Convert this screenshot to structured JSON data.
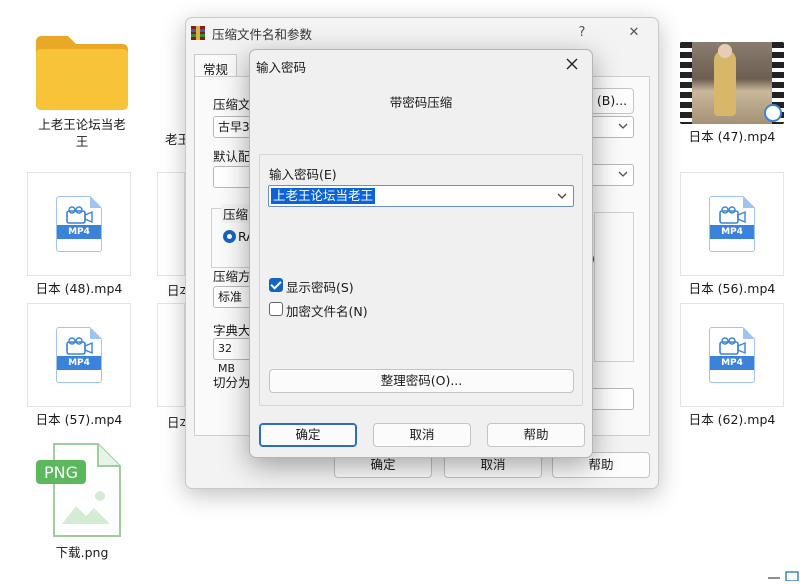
{
  "desktop": {
    "folder_label": "上老王论坛当老王",
    "video_top_right_label": "日本 (47).mp4",
    "png_label": "下载.png",
    "png_badge": "PNG",
    "mp4_badge": "MP4",
    "tiles_mp4": [
      {
        "label": "日本 (48).mp4"
      },
      {
        "label": "日本 (56).mp4"
      },
      {
        "label": "日本 (57).mp4"
      },
      {
        "label": "日本 (62).mp4"
      }
    ],
    "partial_labels": [
      "老王",
      "日本",
      "日本"
    ]
  },
  "back_dialog": {
    "title": "压缩文件名和参数",
    "help_glyph": "?",
    "close_glyph": "✕",
    "tab_general": "常规",
    "label_archive_name": "压缩文",
    "field_archive_name": "古早3",
    "browse_button": "(B)...",
    "label_default_profile": "默认配",
    "label_format": "压缩",
    "radio_format": "RA",
    "label_method": "压缩方",
    "field_method": "标准",
    "label_dict": "字典大",
    "field_dict": "32 MB",
    "label_split": "切分为",
    "stray_paren": ")",
    "ok": "确定",
    "cancel": "取消",
    "help": "帮助"
  },
  "password_dialog": {
    "title": "输入密码",
    "subtitle": "带密码压缩",
    "password_label": "输入密码(E)",
    "password_value": "上老王论坛当老王",
    "show_password": "显示密码(S)",
    "show_password_checked": true,
    "encrypt_filenames": "加密文件名(N)",
    "encrypt_filenames_checked": false,
    "organize_button": "整理密码(O)...",
    "ok": "确定",
    "cancel": "取消",
    "help": "帮助"
  },
  "colors": {
    "accent": "#1565c0",
    "selection": "#0a64d8",
    "folder": "#f7c338"
  }
}
